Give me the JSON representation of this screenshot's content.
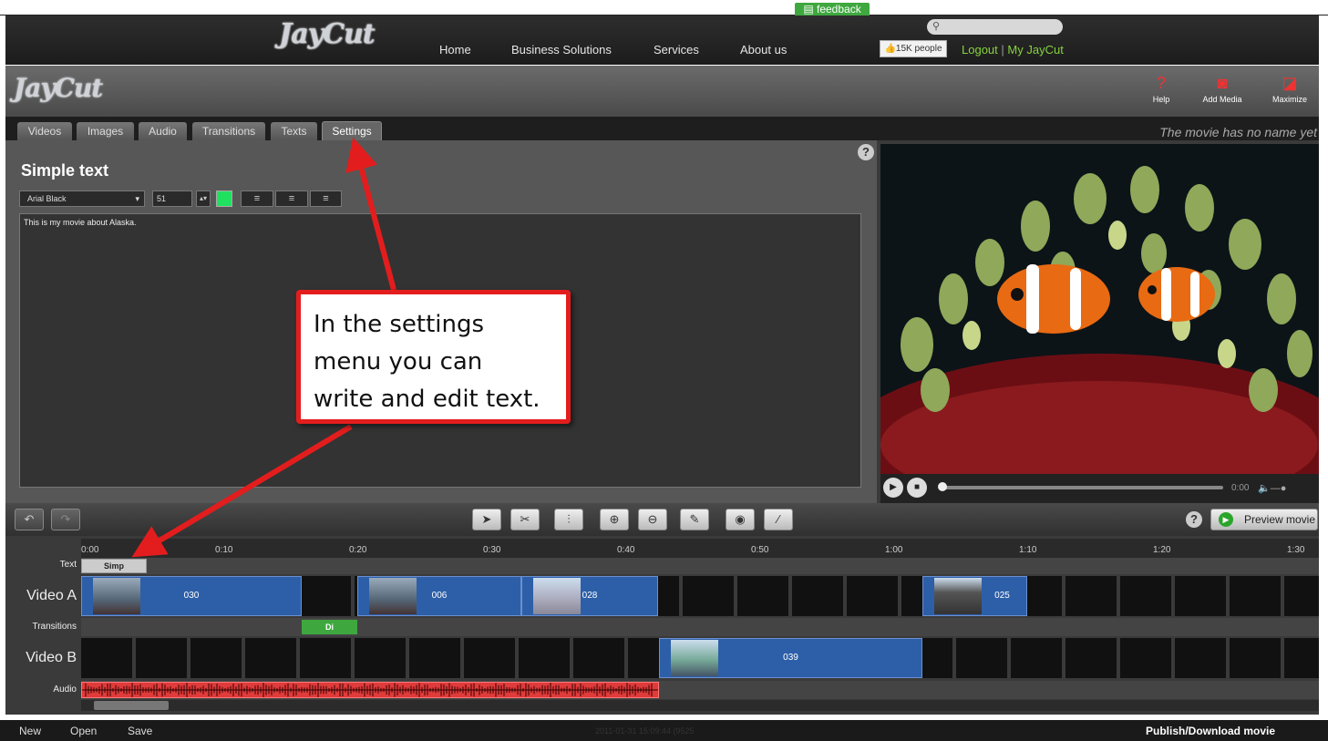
{
  "site": {
    "feedback": "feedback",
    "logo": "JayCut",
    "nav": [
      "Home",
      "Business Solutions",
      "Services",
      "About us"
    ],
    "like": "15K people",
    "logout": "Logout",
    "sep": "|",
    "myjaycut": "My JayCut"
  },
  "app": {
    "logo": "JayCut",
    "tools": [
      {
        "label": "Help",
        "icon": "help-icon"
      },
      {
        "label": "Add Media",
        "icon": "camera-add-icon"
      },
      {
        "label": "Maximize",
        "icon": "maximize-icon"
      }
    ],
    "tabs": [
      "Videos",
      "Images",
      "Audio",
      "Transitions",
      "Texts",
      "Settings"
    ],
    "active_tab": "Settings",
    "movie_name": "The movie has no name yet"
  },
  "editor": {
    "title": "Simple text",
    "font": "Arial Black",
    "size": "51",
    "color": "#20e060",
    "text": "This is my movie about Alaska."
  },
  "player": {
    "time": "0:00"
  },
  "toolbar": {
    "preview_label": "Preview movie"
  },
  "timeline": {
    "ticks": [
      "0:00",
      "0:10",
      "0:20",
      "0:30",
      "0:40",
      "0:50",
      "1:00",
      "1:10",
      "1:20",
      "1:30"
    ],
    "rows": [
      "Text",
      "Video A",
      "Transitions",
      "Video B",
      "Audio"
    ],
    "text_clip": "Simp",
    "video_a": [
      {
        "label": "030"
      },
      {
        "label": "006"
      },
      {
        "label": "028"
      },
      {
        "label": "025"
      }
    ],
    "transition": "Di",
    "video_b": [
      {
        "label": "039"
      }
    ]
  },
  "statusbar": {
    "new": "New",
    "open": "Open",
    "save": "Save",
    "timestamp": "2011-01-31 15:09:44 (9525",
    "publish": "Publish/Download movie"
  },
  "callout": {
    "line1": "In the settings",
    "line2": "menu you can",
    "line3": "write and edit text."
  },
  "colors": {
    "accent": "#e31d1d",
    "clip": "#2d5fa8",
    "audio": "#e03b3b",
    "link": "#86d23e",
    "transition": "#3ea83e"
  }
}
